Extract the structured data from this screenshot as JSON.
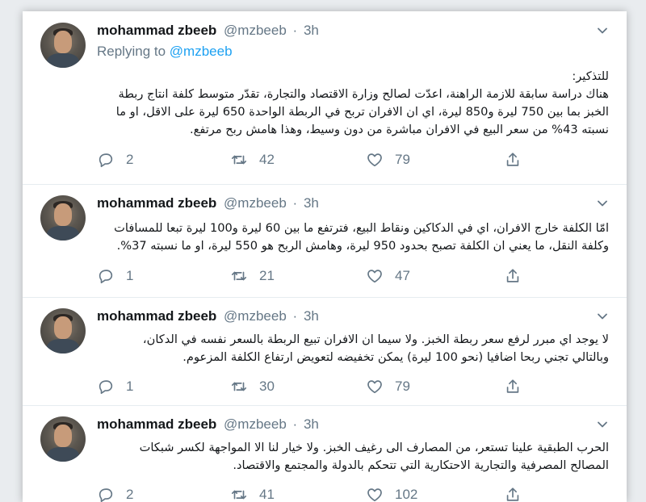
{
  "tweets": [
    {
      "name": "mohammad zbeeb",
      "handle": "@mzbeeb",
      "dot": "·",
      "time": "3h",
      "replying_prefix": "Replying to",
      "replying_to": "@mzbeeb",
      "text_lines": [
        "للتذكير:",
        "هناك دراسة سابقة للازمة الراهنة، اعدّت لصالح وزارة الاقتصاد والتجارة، تقدّر متوسط كلفة انتاج ربطة",
        "الخبز بما بين 750 ليرة و850 ليرة، اي ان الافران تربح في الربطة الواحدة 650 ليرة على الاقل، او ما",
        "نسبته 43% من سعر البيع في الافران مباشرة من دون وسيط، وهذا هامش ربح مرتفع."
      ],
      "replies": "2",
      "retweets": "42",
      "likes": "79"
    },
    {
      "name": "mohammad zbeeb",
      "handle": "@mzbeeb",
      "dot": "·",
      "time": "3h",
      "text_lines": [
        "امّا الكلفة خارج الافران، اي في الدكاكين ونقاط البيع، فترتفع ما بين 60 ليرة و100 ليرة تبعا للمسافات",
        "وكلفة النقل، ما يعني ان الكلفة تصبح بحدود 950 ليرة، وهامش الربح هو 550 ليرة، او ما نسبته 37%."
      ],
      "replies": "1",
      "retweets": "21",
      "likes": "47"
    },
    {
      "name": "mohammad zbeeb",
      "handle": "@mzbeeb",
      "dot": "·",
      "time": "3h",
      "text_lines": [
        "لا يوجد اي مبرر لرفع سعر ربطة الخبز. ولا سيما ان الافران تبيع الربطة بالسعر نفسه في الدكان،",
        "وبالتالي تجني ربحا اضافيا (نحو 100 ليرة) يمكن تخفيضه لتعويض ارتفاع الكلفة المزعوم."
      ],
      "replies": "1",
      "retweets": "30",
      "likes": "79"
    },
    {
      "name": "mohammad zbeeb",
      "handle": "@mzbeeb",
      "dot": "·",
      "time": "3h",
      "text_lines": [
        "الحرب الطبقية علينا تستعر، من المصارف الى رغيف الخبز. ولا خيار لنا الا المواجهة لكسر شبكات",
        "المصالح المصرفية والتجارية الاحتكارية التي تتحكم بالدولة والمجتمع والاقتصاد."
      ],
      "replies": "2",
      "retweets": "41",
      "likes": "102"
    }
  ],
  "icons": {
    "reply": "reply-icon",
    "retweet": "retweet-icon",
    "like": "heart-icon",
    "share": "share-icon",
    "menu": "chevron-down-icon",
    "avatar": "avatar"
  },
  "colors": {
    "link": "#1da1f2",
    "secondary": "#657786",
    "text": "#14171a"
  }
}
